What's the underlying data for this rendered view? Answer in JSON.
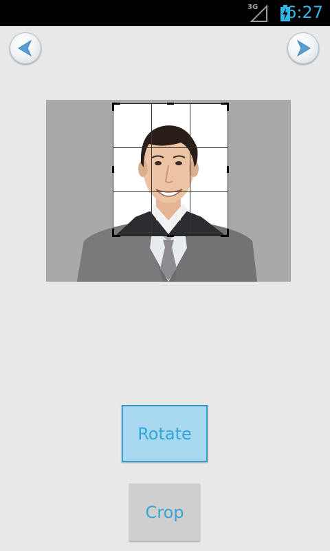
{
  "status_bar": {
    "network_label": "3G",
    "time": "6:27",
    "icons": [
      "signal-icon",
      "battery-charging-icon"
    ]
  },
  "nav": {
    "back_icon": "arrow-left-icon",
    "next_icon": "arrow-right-icon"
  },
  "photo": {
    "subject": "portrait",
    "crop_grid": "3x3"
  },
  "actions": {
    "rotate_label": "Rotate",
    "crop_label": "Crop"
  },
  "colors": {
    "accent": "#33a7d8",
    "rotate_bg": "#a8d8ef",
    "crop_bg": "#cfcfcf",
    "status_bar": "#000000"
  }
}
